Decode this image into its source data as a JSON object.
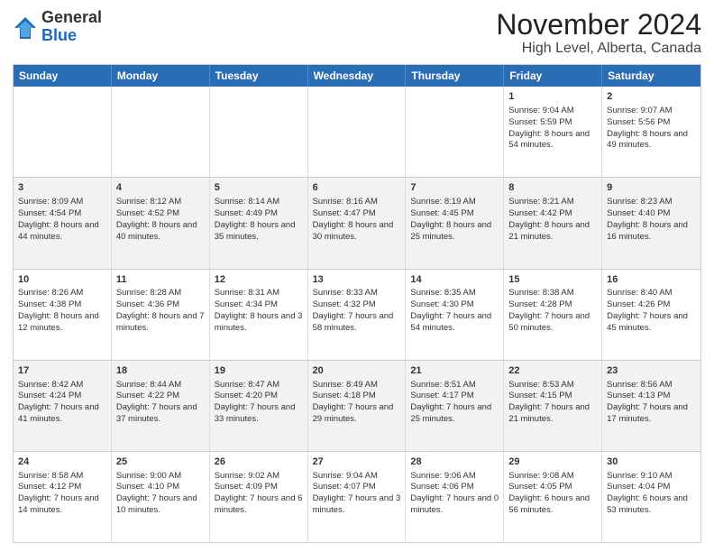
{
  "header": {
    "logo": {
      "general": "General",
      "blue": "Blue"
    },
    "title": "November 2024",
    "subtitle": "High Level, Alberta, Canada"
  },
  "calendar": {
    "days_of_week": [
      "Sunday",
      "Monday",
      "Tuesday",
      "Wednesday",
      "Thursday",
      "Friday",
      "Saturday"
    ],
    "weeks": [
      [
        {
          "day": "",
          "info": ""
        },
        {
          "day": "",
          "info": ""
        },
        {
          "day": "",
          "info": ""
        },
        {
          "day": "",
          "info": ""
        },
        {
          "day": "",
          "info": ""
        },
        {
          "day": "1",
          "info": "Sunrise: 9:04 AM\nSunset: 5:59 PM\nDaylight: 8 hours and 54 minutes."
        },
        {
          "day": "2",
          "info": "Sunrise: 9:07 AM\nSunset: 5:56 PM\nDaylight: 8 hours and 49 minutes."
        }
      ],
      [
        {
          "day": "3",
          "info": "Sunrise: 8:09 AM\nSunset: 4:54 PM\nDaylight: 8 hours and 44 minutes."
        },
        {
          "day": "4",
          "info": "Sunrise: 8:12 AM\nSunset: 4:52 PM\nDaylight: 8 hours and 40 minutes."
        },
        {
          "day": "5",
          "info": "Sunrise: 8:14 AM\nSunset: 4:49 PM\nDaylight: 8 hours and 35 minutes."
        },
        {
          "day": "6",
          "info": "Sunrise: 8:16 AM\nSunset: 4:47 PM\nDaylight: 8 hours and 30 minutes."
        },
        {
          "day": "7",
          "info": "Sunrise: 8:19 AM\nSunset: 4:45 PM\nDaylight: 8 hours and 25 minutes."
        },
        {
          "day": "8",
          "info": "Sunrise: 8:21 AM\nSunset: 4:42 PM\nDaylight: 8 hours and 21 minutes."
        },
        {
          "day": "9",
          "info": "Sunrise: 8:23 AM\nSunset: 4:40 PM\nDaylight: 8 hours and 16 minutes."
        }
      ],
      [
        {
          "day": "10",
          "info": "Sunrise: 8:26 AM\nSunset: 4:38 PM\nDaylight: 8 hours and 12 minutes."
        },
        {
          "day": "11",
          "info": "Sunrise: 8:28 AM\nSunset: 4:36 PM\nDaylight: 8 hours and 7 minutes."
        },
        {
          "day": "12",
          "info": "Sunrise: 8:31 AM\nSunset: 4:34 PM\nDaylight: 8 hours and 3 minutes."
        },
        {
          "day": "13",
          "info": "Sunrise: 8:33 AM\nSunset: 4:32 PM\nDaylight: 7 hours and 58 minutes."
        },
        {
          "day": "14",
          "info": "Sunrise: 8:35 AM\nSunset: 4:30 PM\nDaylight: 7 hours and 54 minutes."
        },
        {
          "day": "15",
          "info": "Sunrise: 8:38 AM\nSunset: 4:28 PM\nDaylight: 7 hours and 50 minutes."
        },
        {
          "day": "16",
          "info": "Sunrise: 8:40 AM\nSunset: 4:26 PM\nDaylight: 7 hours and 45 minutes."
        }
      ],
      [
        {
          "day": "17",
          "info": "Sunrise: 8:42 AM\nSunset: 4:24 PM\nDaylight: 7 hours and 41 minutes."
        },
        {
          "day": "18",
          "info": "Sunrise: 8:44 AM\nSunset: 4:22 PM\nDaylight: 7 hours and 37 minutes."
        },
        {
          "day": "19",
          "info": "Sunrise: 8:47 AM\nSunset: 4:20 PM\nDaylight: 7 hours and 33 minutes."
        },
        {
          "day": "20",
          "info": "Sunrise: 8:49 AM\nSunset: 4:18 PM\nDaylight: 7 hours and 29 minutes."
        },
        {
          "day": "21",
          "info": "Sunrise: 8:51 AM\nSunset: 4:17 PM\nDaylight: 7 hours and 25 minutes."
        },
        {
          "day": "22",
          "info": "Sunrise: 8:53 AM\nSunset: 4:15 PM\nDaylight: 7 hours and 21 minutes."
        },
        {
          "day": "23",
          "info": "Sunrise: 8:56 AM\nSunset: 4:13 PM\nDaylight: 7 hours and 17 minutes."
        }
      ],
      [
        {
          "day": "24",
          "info": "Sunrise: 8:58 AM\nSunset: 4:12 PM\nDaylight: 7 hours and 14 minutes."
        },
        {
          "day": "25",
          "info": "Sunrise: 9:00 AM\nSunset: 4:10 PM\nDaylight: 7 hours and 10 minutes."
        },
        {
          "day": "26",
          "info": "Sunrise: 9:02 AM\nSunset: 4:09 PM\nDaylight: 7 hours and 6 minutes."
        },
        {
          "day": "27",
          "info": "Sunrise: 9:04 AM\nSunset: 4:07 PM\nDaylight: 7 hours and 3 minutes."
        },
        {
          "day": "28",
          "info": "Sunrise: 9:06 AM\nSunset: 4:06 PM\nDaylight: 7 hours and 0 minutes."
        },
        {
          "day": "29",
          "info": "Sunrise: 9:08 AM\nSunset: 4:05 PM\nDaylight: 6 hours and 56 minutes."
        },
        {
          "day": "30",
          "info": "Sunrise: 9:10 AM\nSunset: 4:04 PM\nDaylight: 6 hours and 53 minutes."
        }
      ]
    ]
  }
}
